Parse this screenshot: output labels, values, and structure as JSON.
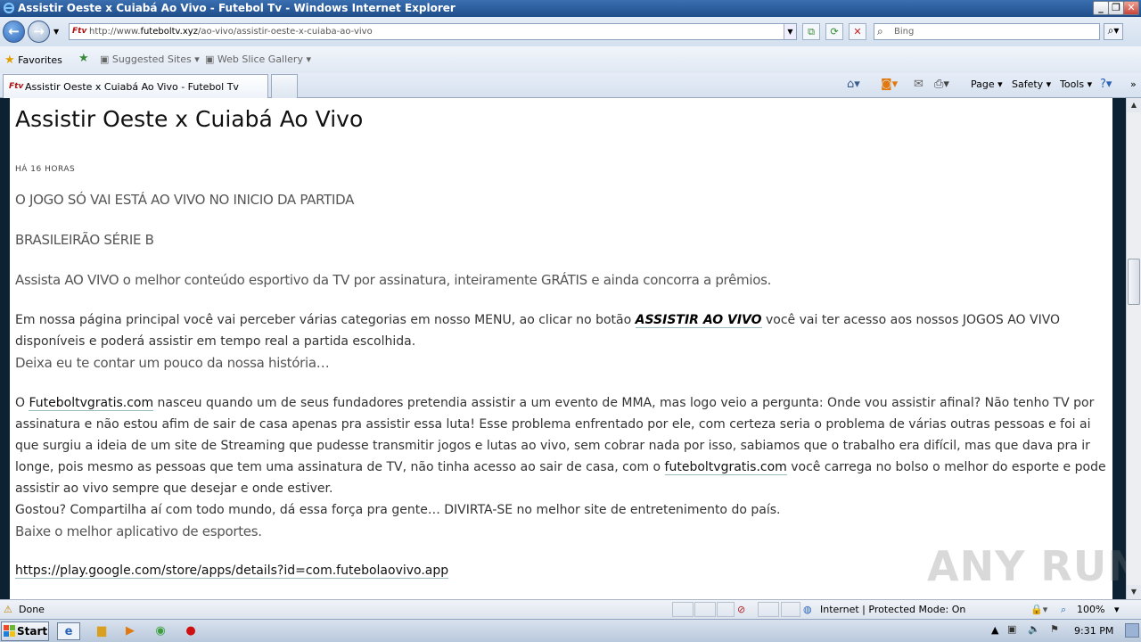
{
  "window": {
    "title": "Assistir Oeste x Cuiabá Ao Vivo - Futebol Tv - Windows Internet Explorer",
    "minimize": "_",
    "restore": "❐",
    "close": "✕"
  },
  "address": {
    "favicon": "Ftv",
    "url_prefix": "http://www.",
    "url_domain": "futeboltv.xyz",
    "url_path": "/ao-vivo/assistir-oeste-x-cuiaba-ao-vivo"
  },
  "search": {
    "placeholder": "Bing"
  },
  "favorites_bar": {
    "favorites_label": "Favorites",
    "suggested_sites": "Suggested Sites ▾",
    "web_slice_gallery": "Web Slice Gallery ▾"
  },
  "tabs": [
    {
      "favicon": "Ftv",
      "label": "Assistir Oeste x Cuiabá Ao Vivo - Futebol Tv"
    }
  ],
  "command_bar": {
    "page": "Page ▾",
    "safety": "Safety ▾",
    "tools": "Tools ▾"
  },
  "content": {
    "title": "Assistir Oeste x Cuiabá Ao Vivo",
    "time": "HÁ 16 HORAS",
    "lead1": "O JOGO SÓ VAI ESTÁ AO VIVO NO INICIO DA PARTIDA",
    "lead2": "BRASILEIRÃO SÉRIE B",
    "lead3": "Assista AO VIVO o melhor conteúdo esportivo da TV por assinatura, inteiramente GRÁTIS e ainda concorra a prêmios.",
    "p1_before": "Em nossa página principal você vai perceber várias categorias em nosso MENU, ao clicar no botão ",
    "p1_link": "ASSISTIR AO VIVO",
    "p1_after": "  você vai ter acesso aos nossos JOGOS AO VIVO disponíveis e poderá assistir em tempo real a partida escolhida.",
    "lead4": "Deixa eu te contar um pouco da nossa história…",
    "p2_start": "O ",
    "p2_link1": "Futeboltvgratis.com",
    "p2_mid": " nasceu quando um de seus fundadores pretendia assistir a um evento de MMA, mas logo veio a pergunta:  Onde vou assistir afinal?  Não tenho TV por assinatura e não estou afim de sair de casa apenas pra assistir essa luta! Esse problema enfrentado por ele, com certeza seria o problema de várias outras pessoas e foi ai que surgiu a ideia de um site de Streaming que pudesse transmitir jogos e lutas ao vivo, sem cobrar nada por isso, sabiamos que o trabalho era difícil, mas que dava pra ir longe, pois mesmo as pessoas que tem uma assinatura de TV, não tinha acesso ao sair de casa, com o ",
    "p2_link2": "futeboltvgratis.com",
    "p2_end": " você carrega no bolso o melhor do esporte e pode assistir ao vivo sempre que desejar e onde estiver.",
    "p3": "Gostou? Compartilha aí com todo mundo, dá essa força pra gente… DIVIRTA-SE no melhor site de entretenimento do país.",
    "lead5": "Baixe o melhor aplicativo de esportes.",
    "app_link": "https://play.google.com/store/apps/details?id=com.futebolaovivo.app"
  },
  "status": {
    "text": "Done",
    "zone": "Internet | Protected Mode: On",
    "zoom": "100%"
  },
  "taskbar": {
    "start": "Start",
    "time": "9:31 PM"
  },
  "watermark": "ANY RUN"
}
